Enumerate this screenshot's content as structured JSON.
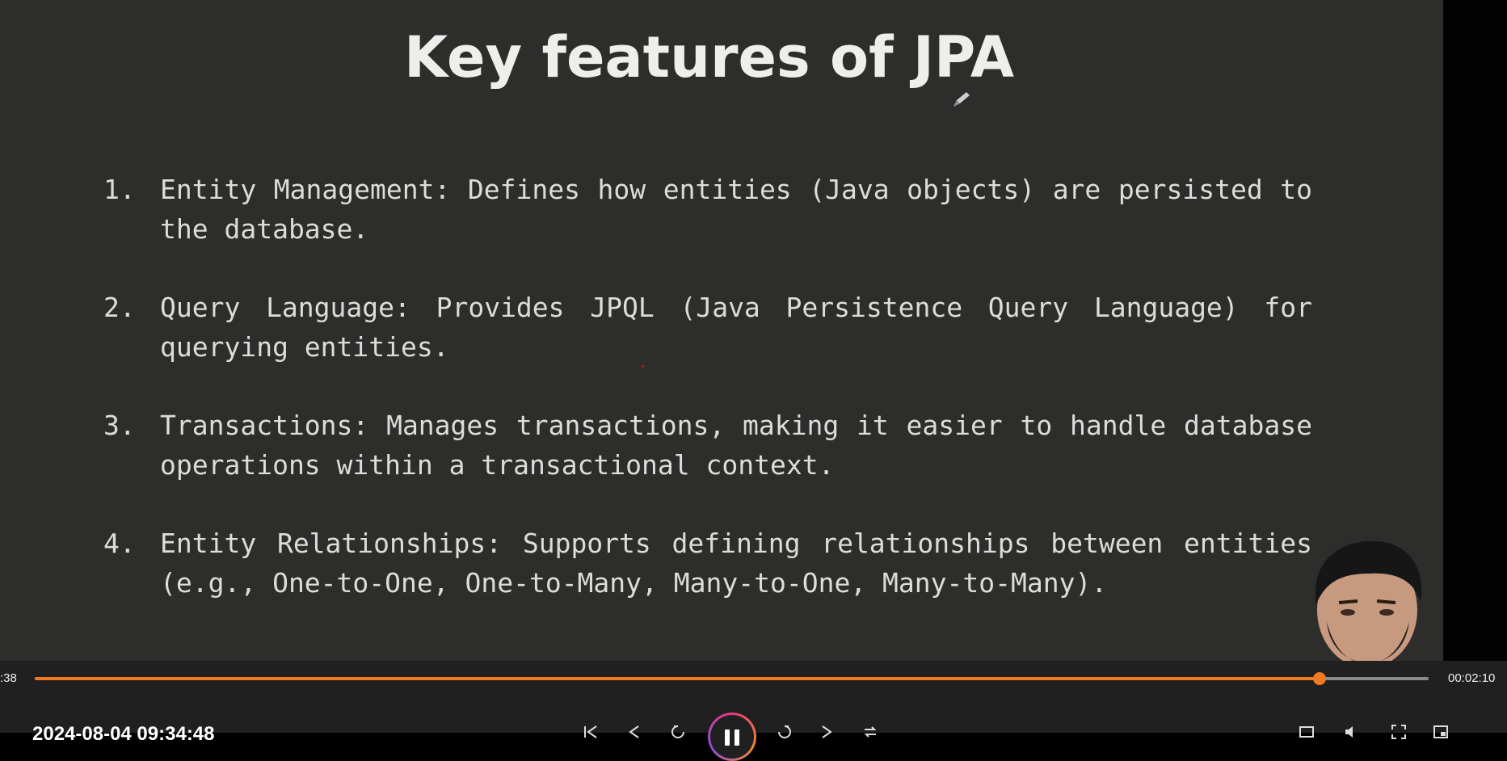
{
  "slide": {
    "title": "Key features of JPA",
    "items": [
      {
        "number": "1.",
        "text": "Entity Management: Defines how entities (Java objects) are persisted to the database."
      },
      {
        "number": "2.",
        "text": "Query Language: Provides JPQL (Java Persistence Query Language) for querying entities."
      },
      {
        "number": "3.",
        "text": "Transactions: Manages transactions, making it easier to handle database operations within a transactional context."
      },
      {
        "number": "4.",
        "text": "Entity Relationships: Supports defining relationships between entities (e.g., One-to-One, One-to-Many, Many-to-One, Many-to-Many)."
      }
    ]
  },
  "player": {
    "current_time": ":38",
    "total_time": "00:02:10",
    "progress_fraction": 0.922,
    "recording_date": "2024-08-04 09:34:48",
    "accent_color": "#f07a22"
  },
  "icons": [
    "pencil-icon",
    "skip-back-icon",
    "previous-icon",
    "rewind-icon",
    "pause-icon",
    "forward-icon",
    "next-icon",
    "repeat-icon",
    "subtitles-icon",
    "volume-icon",
    "fullscreen-icon",
    "pip-icon"
  ]
}
